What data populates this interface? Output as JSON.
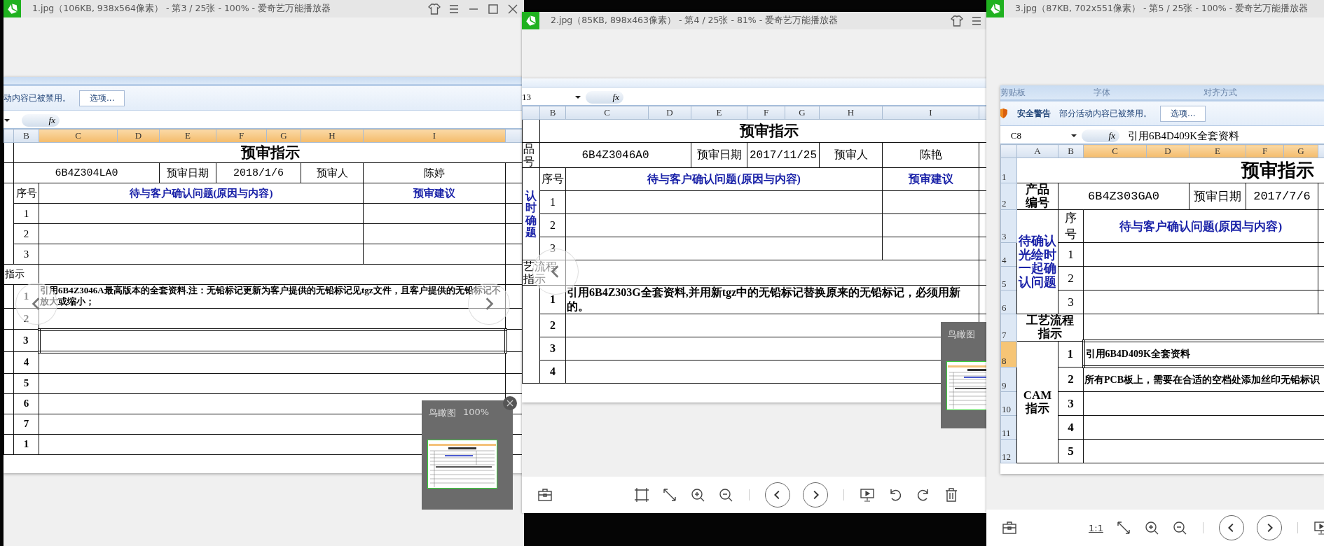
{
  "windows": [
    {
      "title": "1.jpg（106KB, 938x564像素） - 第3 / 25张 - 100% - 爱奇艺万能播放器",
      "sheet": {
        "security": {
          "message": "动内容已被禁用。",
          "button": "选项..."
        },
        "formula_bar": {
          "function_label": "fx"
        },
        "columns": [
          {
            "highlighted": false
          },
          {
            "label": "B",
            "highlighted": false
          },
          {
            "label": "C",
            "highlighted": true
          },
          {
            "label": "D",
            "highlighted": true
          },
          {
            "label": "E",
            "highlighted": true
          },
          {
            "label": "F",
            "highlighted": true
          },
          {
            "label": "G",
            "highlighted": true
          },
          {
            "label": "H",
            "highlighted": true
          },
          {
            "label": "I",
            "highlighted": true
          },
          {
            "highlighted": false
          }
        ],
        "rows": [
          {
            "selected": false,
            "cells": [
              {
                "kind": "blank"
              },
              {
                "kind": "title",
                "text": "预审指示",
                "colspan": 9
              }
            ]
          },
          {
            "selected": false,
            "cells": [
              {
                "kind": "blank"
              },
              {
                "kind": "value",
                "text": "6B4Z304LA0",
                "colspan": 3
              },
              {
                "kind": "label",
                "text": "预审日期"
              },
              {
                "kind": "value",
                "text": "2018/1/6",
                "colspan": 2
              },
              {
                "kind": "label",
                "text": "预审人"
              },
              {
                "kind": "label",
                "text": "陈婷"
              },
              {
                "kind": "blank"
              }
            ]
          },
          {
            "selected": false,
            "cells": [
              {
                "kind": "blank",
                "rowspan": 4
              },
              {
                "kind": "label",
                "text": "序号"
              },
              {
                "kind": "heading",
                "text": "待与客户确认问题(原因与内容)",
                "colspan": 6
              },
              {
                "kind": "heading",
                "text": "预审建议"
              },
              {
                "kind": "blank"
              }
            ]
          },
          {
            "selected": false,
            "cells": [
              {
                "kind": "seq",
                "text": "1"
              },
              {
                "kind": "blank",
                "colspan": 6
              },
              {
                "kind": "blank"
              },
              {
                "kind": "blank"
              }
            ]
          },
          {
            "selected": false,
            "cells": [
              {
                "kind": "seq",
                "text": "2"
              },
              {
                "kind": "blank",
                "colspan": 6
              },
              {
                "kind": "blank"
              },
              {
                "kind": "blank"
              }
            ]
          },
          {
            "selected": false,
            "cells": [
              {
                "kind": "seq",
                "text": "3"
              },
              {
                "kind": "blank",
                "colspan": 6
              },
              {
                "kind": "blank"
              },
              {
                "kind": "blank"
              }
            ]
          },
          {
            "selected": false,
            "cells": [
              {
                "kind": "side",
                "text": "指示",
                "colspan": 2
              },
              {
                "kind": "blank",
                "colspan": 7
              },
              {
                "kind": "blank"
              }
            ]
          },
          {
            "selected": false,
            "cells": [
              {
                "kind": "blank"
              },
              {
                "kind": "seq_bold",
                "text": "1"
              },
              {
                "kind": "note",
                "text": "引用6B4Z3046A最高版本的全套资料.注：无铅标记更新为客户提供的无铅标记见tgz文件，且客户提供的无铅标记不放大或缩小；",
                "colspan": 7
              },
              {
                "kind": "blank"
              }
            ]
          },
          {
            "selected": false,
            "cells": [
              {
                "kind": "blank"
              },
              {
                "kind": "seq_bold",
                "text": "2"
              },
              {
                "kind": "blank",
                "colspan": 7
              },
              {
                "kind": "blank"
              }
            ]
          },
          {
            "selected": true,
            "cells": [
              {
                "kind": "blank"
              },
              {
                "kind": "seq_bold",
                "text": "3"
              },
              {
                "kind": "blank",
                "colspan": 7
              },
              {
                "kind": "blank"
              }
            ]
          },
          {
            "selected": false,
            "cells": [
              {
                "kind": "blank"
              },
              {
                "kind": "seq_bold",
                "text": "4"
              },
              {
                "kind": "blank",
                "colspan": 7
              },
              {
                "kind": "blank"
              }
            ]
          },
          {
            "selected": false,
            "cells": [
              {
                "kind": "blank"
              },
              {
                "kind": "seq_bold",
                "text": "5"
              },
              {
                "kind": "blank",
                "colspan": 7
              },
              {
                "kind": "blank"
              }
            ]
          },
          {
            "selected": false,
            "cells": [
              {
                "kind": "blank"
              },
              {
                "kind": "seq_bold",
                "text": "6"
              },
              {
                "kind": "blank",
                "colspan": 7
              },
              {
                "kind": "blank"
              }
            ]
          },
          {
            "selected": false,
            "cells": [
              {
                "kind": "blank"
              },
              {
                "kind": "seq_bold",
                "text": "7"
              },
              {
                "kind": "blank",
                "colspan": 7
              },
              {
                "kind": "blank"
              }
            ]
          },
          {
            "selected": false,
            "cells": [
              {
                "kind": "blank"
              },
              {
                "kind": "seq_bold",
                "text": "1"
              },
              {
                "kind": "blank",
                "colspan": 7
              },
              {
                "kind": "blank"
              }
            ]
          }
        ]
      },
      "nav": [
        {
          "kind": "prev"
        },
        {
          "kind": "next"
        }
      ],
      "birdseye": {
        "title": "鸟瞰图",
        "zoom": "100%",
        "closable": true
      }
    },
    {
      "title": "2.jpg（85KB, 898x463像素） - 第4 / 25张 - 81% - 爱奇艺万能播放器",
      "sheet": {
        "formula_bar": {
          "name_box": "13",
          "function_label": "fx"
        },
        "columns": [
          {
            "highlighted": false
          },
          {
            "label": "B",
            "highlighted": false
          },
          {
            "label": "C",
            "highlighted": false
          },
          {
            "label": "D",
            "highlighted": false
          },
          {
            "label": "E",
            "highlighted": false
          },
          {
            "label": "F",
            "highlighted": false
          },
          {
            "label": "G",
            "highlighted": false
          },
          {
            "label": "H",
            "highlighted": false
          },
          {
            "label": "I",
            "highlighted": false
          },
          {
            "highlighted": false
          }
        ],
        "rows": [
          {
            "selected": false,
            "cells": [
              {
                "kind": "blank"
              },
              {
                "kind": "title",
                "text": "预审指示",
                "colspan": 9
              }
            ]
          },
          {
            "selected": false,
            "cells": [
              {
                "kind": "side",
                "text": "品号"
              },
              {
                "kind": "value",
                "text": "6B4Z3046A0",
                "colspan": 3
              },
              {
                "kind": "label",
                "text": "预审日期"
              },
              {
                "kind": "value",
                "text": "2017/11/25",
                "colspan": 2
              },
              {
                "kind": "label",
                "text": "预审人"
              },
              {
                "kind": "label",
                "text": "陈艳"
              },
              {
                "kind": "blank"
              }
            ]
          },
          {
            "selected": false,
            "cells": [
              {
                "kind": "side_heading",
                "text": "认时确题",
                "rowspan": 4
              },
              {
                "kind": "label",
                "text": "序号"
              },
              {
                "kind": "heading",
                "text": "待与客户确认问题(原因与内容)",
                "colspan": 6
              },
              {
                "kind": "heading",
                "text": "预审建议"
              },
              {
                "kind": "blank"
              }
            ]
          },
          {
            "selected": false,
            "cells": [
              {
                "kind": "seq",
                "text": "1"
              },
              {
                "kind": "blank",
                "colspan": 6
              },
              {
                "kind": "blank"
              },
              {
                "kind": "blank"
              }
            ]
          },
          {
            "selected": false,
            "cells": [
              {
                "kind": "seq",
                "text": "2"
              },
              {
                "kind": "blank",
                "colspan": 6
              },
              {
                "kind": "blank"
              },
              {
                "kind": "blank"
              }
            ]
          },
          {
            "selected": false,
            "cells": [
              {
                "kind": "seq",
                "text": "3"
              },
              {
                "kind": "blank",
                "colspan": 6
              },
              {
                "kind": "blank"
              },
              {
                "kind": "blank"
              }
            ]
          },
          {
            "selected": false,
            "cells": [
              {
                "kind": "side",
                "text": "艺流程指示",
                "colspan": 2
              },
              {
                "kind": "blank",
                "colspan": 7
              },
              {
                "kind": "blank"
              }
            ]
          },
          {
            "selected": false,
            "cells": [
              {
                "kind": "blank",
                "rowspan": 4
              },
              {
                "kind": "seq_bold",
                "text": "1"
              },
              {
                "kind": "note",
                "text": "引用6B4Z303G全套资料,并用新tgz中的无铅标记替换原来的无铅标记，必须用新的。",
                "colspan": 7
              },
              {
                "kind": "blank"
              }
            ]
          },
          {
            "selected": false,
            "cells": [
              {
                "kind": "seq_bold",
                "text": "2"
              },
              {
                "kind": "blank",
                "colspan": 7
              },
              {
                "kind": "blank"
              }
            ]
          },
          {
            "selected": false,
            "cells": [
              {
                "kind": "seq_bold",
                "text": "3"
              },
              {
                "kind": "blank",
                "colspan": 7
              },
              {
                "kind": "blank"
              }
            ]
          },
          {
            "selected": false,
            "cells": [
              {
                "kind": "seq_bold",
                "text": "4"
              },
              {
                "kind": "blank",
                "colspan": 7
              },
              {
                "kind": "blank"
              }
            ]
          }
        ]
      },
      "nav": [
        {
          "kind": "prev"
        }
      ],
      "birdseye": {
        "title": "鸟瞰图",
        "closable": false
      },
      "toolbar": {
        "kind": "fit"
      }
    },
    {
      "title": "3.jpg（87KB, 702x551像素） - 第5 / 25张 - 100% - 爱奇艺万能播放器",
      "sheet": {
        "ribbon_groups": [
          "剪贴板",
          "字体",
          "对齐方式"
        ],
        "security": {
          "label": "安全警告",
          "message": "部分活动内容已被禁用。",
          "button": "选项..."
        },
        "formula_bar": {
          "name_box": "C8",
          "function_label": "fx",
          "formula": "引用6B4D409K全套资料"
        },
        "columns": [
          {
            "label": "A",
            "highlighted": false
          },
          {
            "label": "B",
            "highlighted": false
          },
          {
            "label": "C",
            "highlighted": true
          },
          {
            "label": "D",
            "highlighted": true
          },
          {
            "label": "E",
            "highlighted": true
          },
          {
            "label": "F",
            "highlighted": true
          },
          {
            "label": "G",
            "highlighted": true
          },
          {
            "highlighted": false
          }
        ],
        "rows": [
          {
            "number": "1",
            "selected": false,
            "cells": [
              {
                "kind": "title",
                "text": "预审指示",
                "colspan": 8
              }
            ]
          },
          {
            "number": "2",
            "selected": false,
            "cells": [
              {
                "kind": "side",
                "text": "产品编号"
              },
              {
                "kind": "value",
                "text": "6B4Z303GA0",
                "colspan": 3
              },
              {
                "kind": "label",
                "text": "预审日期"
              },
              {
                "kind": "value",
                "text": "2017/7/6",
                "colspan": 2
              },
              {
                "kind": "blank"
              }
            ]
          },
          {
            "number": "3",
            "selected": false,
            "cells": [
              {
                "kind": "side_heading",
                "text": "待确认光绘时一起确认问题",
                "rowspan": 4
              },
              {
                "kind": "label",
                "text": "序号"
              },
              {
                "kind": "heading",
                "text": "待与客户确认问题(原因与内容)",
                "colspan": 5
              },
              {
                "kind": "blank"
              }
            ]
          },
          {
            "number": "4",
            "selected": false,
            "cells": [
              {
                "kind": "seq",
                "text": "1"
              },
              {
                "kind": "blank",
                "colspan": 5
              },
              {
                "kind": "blank"
              }
            ]
          },
          {
            "number": "5",
            "selected": false,
            "cells": [
              {
                "kind": "seq",
                "text": "2"
              },
              {
                "kind": "blank",
                "colspan": 5
              },
              {
                "kind": "blank"
              }
            ]
          },
          {
            "number": "6",
            "selected": false,
            "cells": [
              {
                "kind": "seq",
                "text": "3"
              },
              {
                "kind": "blank",
                "colspan": 5
              },
              {
                "kind": "blank"
              }
            ]
          },
          {
            "number": "7",
            "selected": false,
            "cells": [
              {
                "kind": "side",
                "text": "工艺流程指示",
                "colspan": 2
              },
              {
                "kind": "blank",
                "colspan": 6
              }
            ]
          },
          {
            "number": "8",
            "selected": true,
            "cells": [
              {
                "kind": "side",
                "text": "CAM指示",
                "rowspan": 5
              },
              {
                "kind": "seq_bold",
                "text": "1"
              },
              {
                "kind": "note",
                "text": "引用6B4D409K全套资料",
                "colspan": 6
              }
            ]
          },
          {
            "number": "9",
            "selected": false,
            "cells": [
              {
                "kind": "seq_bold",
                "text": "2"
              },
              {
                "kind": "note",
                "text": "所有PCB板上，需要在合适的空档处添加丝印无铅标识",
                "colspan": 6
              }
            ]
          },
          {
            "number": "10",
            "selected": false,
            "cells": [
              {
                "kind": "seq_bold",
                "text": "3"
              },
              {
                "kind": "blank",
                "colspan": 6
              }
            ]
          },
          {
            "number": "11",
            "selected": false,
            "cells": [
              {
                "kind": "seq_bold",
                "text": "4"
              },
              {
                "kind": "blank",
                "colspan": 6
              }
            ]
          },
          {
            "number": "12",
            "selected": false,
            "cells": [
              {
                "kind": "seq_bold",
                "text": "5"
              },
              {
                "kind": "blank",
                "colspan": 6
              }
            ]
          }
        ]
      },
      "toolbar": {
        "kind": "actual_size",
        "label": "1:1"
      }
    }
  ]
}
